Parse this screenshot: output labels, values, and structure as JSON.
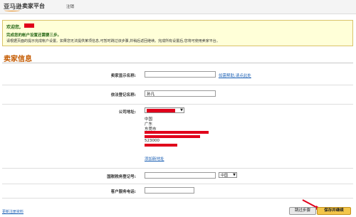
{
  "header": {
    "logo_text": "亚马逊",
    "platform_title": "卖家平台",
    "signout_label": "注销"
  },
  "welcome": {
    "greeting": "欢迎您,",
    "step_text": "完成您的帐户设置还需要三步。",
    "instructions": "请根据页面的提示完成帐户设置。如果您无法提供某项信息,可暂时跳过该步骤,并稍后返回继续。完成所有设置后,您将可使用卖家平台。"
  },
  "section_title": "卖家信息",
  "form": {
    "display_name_label": "卖家显示名称:",
    "display_name_value": "",
    "display_name_help_link": "如需帮助,请点此处",
    "legal_name_label": "依法登记名称:",
    "legal_name_value": "孙凡",
    "address_label": "公司地址:",
    "address_lines": [
      "中国",
      "广东",
      "东莞市"
    ],
    "postcode": "523000",
    "add_address_link": "添加新地址",
    "tax_id_label": "国税税务登记号:",
    "tax_id_value": "",
    "country_select_value": "中国",
    "phone_label": "客户服务电话:",
    "phone_value": ""
  },
  "footer": {
    "back_link": "更新注册资料",
    "skip_button": "跳过步骤",
    "save_button": "保存并继续"
  },
  "colors": {
    "accent_orange": "#c45a00",
    "redaction_red": "#e0001b",
    "welcome_bg": "#ffffd8",
    "link_blue": "#1a5fb4",
    "save_button_yellow": "#f3c64a"
  }
}
